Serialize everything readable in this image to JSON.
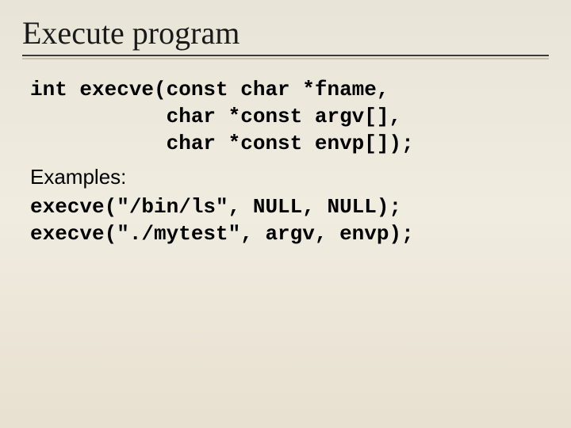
{
  "title": "Execute program",
  "signature": {
    "line1": "int execve(const char *fname,",
    "line2": "           char *const argv[],",
    "line3": "           char *const envp[]);"
  },
  "examples_label": "Examples:",
  "examples": {
    "line1": "execve(\"/bin/ls\", NULL, NULL);",
    "line2": "execve(\"./mytest\", argv, envp);"
  }
}
